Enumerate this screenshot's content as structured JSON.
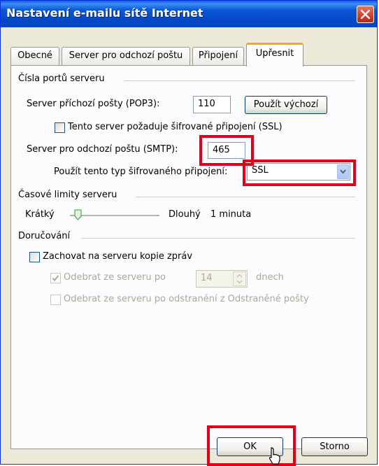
{
  "window": {
    "title": "Nastavení e-mailu sítě Internet"
  },
  "tabs": [
    "Obecné",
    "Server pro odchozí poštu",
    "Připojení",
    "Upřesnit"
  ],
  "active_tab": "Upřesnit",
  "ports": {
    "group_label": "Čísla portů serveru",
    "incoming_label": "Server příchozí pošty (POP3):",
    "incoming_value": "110",
    "use_default_label": "Použít výchozí",
    "ssl_incoming_label": "Tento server požaduje šifrované připojení (SSL)",
    "outgoing_label": "Server pro odchozí poštu (SMTP):",
    "outgoing_value": "465",
    "encryption_label": "Použít tento typ šifrovaného připojení:",
    "encryption_value": "SSL"
  },
  "timeouts": {
    "group_label": "Časové limity serveru",
    "short_label": "Krátký",
    "long_label": "Dlouhý",
    "value_label": "1 minuta"
  },
  "delivery": {
    "group_label": "Doručování",
    "keep_copy_label": "Zachovat na serveru kopie zpráv",
    "remove_after_label": "Odebrat ze serveru po",
    "remove_after_value": "14",
    "days_label": "dnech",
    "remove_when_deleted_label": "Odebrat ze serveru po odstranění z Odstraněné pošty"
  },
  "buttons": {
    "ok": "OK",
    "cancel": "Storno"
  }
}
